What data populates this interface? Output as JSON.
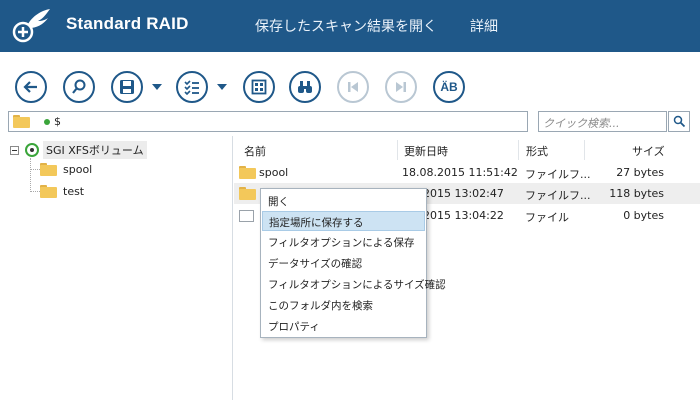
{
  "header": {
    "app_title": "Standard RAID",
    "menu": [
      "保存したスキャン結果を開く",
      "詳細"
    ],
    "bg_color": "#1f5889"
  },
  "toolbar": {
    "buttons": [
      {
        "name": "back-button",
        "icon": "arrow-left-icon"
      },
      {
        "name": "find-button",
        "icon": "search-icon"
      },
      {
        "name": "save-button",
        "icon": "floppy-disk-icon"
      },
      {
        "name": "list-options-button",
        "icon": "checklist-icon"
      },
      {
        "name": "view-mode-button",
        "icon": "grid-icon"
      },
      {
        "name": "binoculars-button",
        "icon": "binoculars-icon"
      },
      {
        "name": "previous-button",
        "icon": "skip-back-icon",
        "disabled": true
      },
      {
        "name": "next-button",
        "icon": "skip-forward-icon",
        "disabled": true
      },
      {
        "name": "charset-button",
        "icon": "text-encoding-icon",
        "label": "ÄB"
      }
    ]
  },
  "address": {
    "path": "$",
    "search_placeholder": "クイック検索..."
  },
  "tree": {
    "root": "SGI XFSボリューム",
    "children": [
      "spool",
      "test"
    ]
  },
  "list": {
    "columns": [
      "名前",
      "更新日時",
      "形式",
      "サイズ"
    ],
    "rows": [
      {
        "name": "spool",
        "date": "18.08.2015 11:51:42",
        "type": "ファイルフ...",
        "size": "27 bytes",
        "icon": "folder-icon"
      },
      {
        "name": "",
        "date": "...9.2015 13:02:47",
        "type": "ファイルフ...",
        "size": "118 bytes",
        "icon": "folder-icon",
        "selected": true
      },
      {
        "name": "",
        "date": "...9.2015 13:04:22",
        "type": "ファイル",
        "size": "0 bytes",
        "icon": "file-icon"
      }
    ]
  },
  "context_menu": {
    "items": [
      "開く",
      "指定場所に保存する",
      "フィルタオプションによる保存",
      "データサイズの確認",
      "フィルタオプションによるサイズ確認",
      "このフォルダ内を検索",
      "プロパティ"
    ],
    "highlighted_index": 1
  }
}
